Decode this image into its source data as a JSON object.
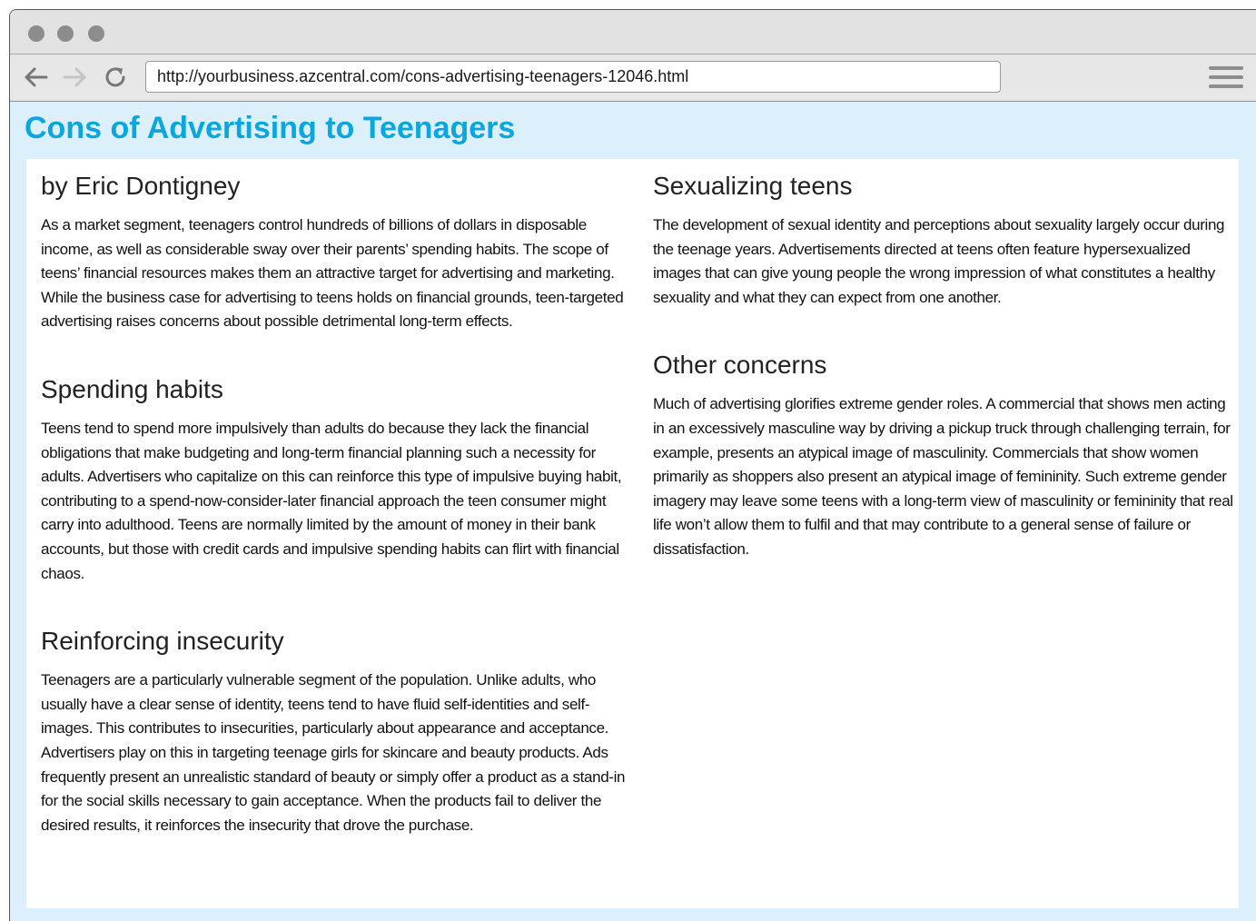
{
  "browser": {
    "url": "http://yourbusiness.azcentral.com/cons-advertising-teenagers-12046.html",
    "window_buttons": [
      "close",
      "minimize",
      "maximize"
    ],
    "nav_icons": [
      "back-arrow-icon",
      "forward-arrow-icon",
      "reload-icon",
      "hamburger-menu-icon"
    ],
    "forward_disabled": true
  },
  "article": {
    "title": "Cons of Advertising to Teenagers",
    "left_column": [
      {
        "heading": "by Eric Dontigney",
        "body": "As a market segment, teenagers control hundreds of billions of dollars in disposable income, as well as considerable sway over their parents’ spending habits. The scope of teens’ financial resources makes them an attractive target for advertising and marketing. While the business case for advertising to teens holds on financial grounds, teen-targeted advertising raises concerns about possible detrimental long-term effects."
      },
      {
        "heading": "Spending habits",
        "body": "Teens tend to spend more impulsively than adults do because they lack the financial obligations that make budgeting and long-term financial planning such a necessity for adults. Advertisers who capitalize on this can reinforce this type of impulsive buying habit, contributing to a spend-now-consider-later financial approach the teen consumer might carry into adulthood. Teens are normally limited by the amount of money in their bank accounts, but those with credit cards and impulsive spending habits can flirt with financial chaos."
      },
      {
        "heading": "Reinforcing insecurity",
        "body": "Teenagers are a particularly vulnerable segment of the population. Unlike adults, who usually have a clear sense of identity, teens tend to have fluid self-identities and self-images. This contributes to insecurities, particularly about appearance and acceptance. Advertisers play on this in targeting teenage girls for skincare and beauty products. Ads frequently present an unrealistic standard of beauty or simply offer a product as a stand-in for the social skills necessary to gain acceptance. When the products fail to deliver the desired results, it reinforces the insecurity that drove the purchase."
      }
    ],
    "right_column": [
      {
        "heading": "Sexualizing teens",
        "body": "The development of sexual identity and perceptions about sexuality largely occur during the teenage years. Advertisements directed at teens often feature hypersexualized images that can give young people the wrong impression of what constitutes a healthy sexuality and what they can expect from one another."
      },
      {
        "heading": "Other concerns",
        "body": "Much of advertising glorifies extreme gender roles. A commercial that shows men acting in an excessively masculine way by driving a pickup truck through challenging terrain, for example, presents an atypical image of masculinity. Commercials that show women primarily as shoppers also present an atypical image of femininity. Such extreme gender imagery may leave some teens with a long-term view of masculinity or femininity that real life won’t allow them to fulfil and that may contribute to a general sense of failure or dissatisfaction."
      }
    ]
  },
  "colors": {
    "title": "#0aa6e0",
    "page_background": "#dcf0fb",
    "panel_background": "#ffffff",
    "chrome": "#e2e2e2",
    "chrome_icons": "#8d8d8d"
  }
}
